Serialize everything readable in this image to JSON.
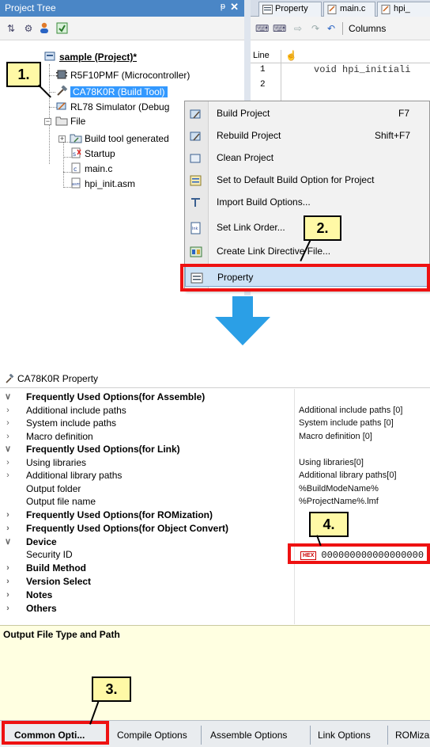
{
  "project_tree": {
    "title": "Project Tree",
    "pin_glyph": "ᵽ",
    "close_glyph": "✕",
    "items": [
      {
        "label": "sample (Project)*"
      },
      {
        "label": "R5F10PMF (Microcontroller)"
      },
      {
        "label": "CA78K0R (Build Tool)"
      },
      {
        "label": "RL78 Simulator (Debug"
      },
      {
        "label": "File"
      },
      {
        "label": "Build tool generated"
      },
      {
        "label": "Startup"
      },
      {
        "label": "main.c"
      },
      {
        "label": "hpi_init.asm"
      }
    ]
  },
  "editor": {
    "tabs": [
      {
        "label": "Property"
      },
      {
        "label": "main.c"
      },
      {
        "label": "hpi_"
      }
    ],
    "columns_label": "Columns",
    "line_header": "Line",
    "lines": [
      {
        "num": "1",
        "code": "void hpi_initiali"
      },
      {
        "num": "2",
        "code": ""
      }
    ]
  },
  "context_menu": {
    "items": [
      {
        "label": "Build Project",
        "shortcut": "F7"
      },
      {
        "label": "Rebuild Project",
        "shortcut": "Shift+F7"
      },
      {
        "label": "Clean Project",
        "shortcut": ""
      },
      {
        "label": "Set to Default Build Option for Project",
        "shortcut": ""
      },
      {
        "label": "Import Build Options...",
        "shortcut": ""
      },
      {
        "label": "Set Link Order...",
        "shortcut": ""
      },
      {
        "label": "Create Link Directive File...",
        "shortcut": ""
      },
      {
        "label": "Property",
        "shortcut": ""
      }
    ]
  },
  "callouts": {
    "c1": "1.",
    "c2": "2.",
    "c3": "3.",
    "c4": "4."
  },
  "property_panel": {
    "title": "CA78K0R Property",
    "rows": [
      {
        "name": "Frequently Used Options(for Assemble)",
        "value": "",
        "chev": "∨"
      },
      {
        "name": "Additional include paths",
        "value": "Additional include paths [0]",
        "chev": "›"
      },
      {
        "name": "System include paths",
        "value": "System include paths [0]",
        "chev": "›"
      },
      {
        "name": "Macro definition",
        "value": "Macro definition [0]",
        "chev": "›"
      },
      {
        "name": "Frequently Used Options(for Link)",
        "value": "",
        "chev": "∨"
      },
      {
        "name": "Using libraries",
        "value": "Using libraries[0]",
        "chev": "›"
      },
      {
        "name": "Additional library paths",
        "value": "Additional library paths[0]",
        "chev": "›"
      },
      {
        "name": "Output folder",
        "value": "%BuildModeName%",
        "chev": ""
      },
      {
        "name": "Output file name",
        "value": "%ProjectName%.lmf",
        "chev": ""
      },
      {
        "name": "Frequently Used Options(for ROMization)",
        "value": "",
        "chev": "›"
      },
      {
        "name": "Frequently Used Options(for Object Convert)",
        "value": "",
        "chev": "›"
      },
      {
        "name": "Device",
        "value": "",
        "chev": "∨"
      },
      {
        "name": "Security ID",
        "value": "000000000000000000",
        "chev": ""
      },
      {
        "name": "Build Method",
        "value": "",
        "chev": "›"
      },
      {
        "name": "Version Select",
        "value": "",
        "chev": "›"
      },
      {
        "name": "Notes",
        "value": "",
        "chev": "›"
      },
      {
        "name": "Others",
        "value": "",
        "chev": "›"
      }
    ],
    "hex_badge": "HEX",
    "description_title": "Output File Type and Path",
    "tabs": [
      {
        "label": "Common Opti..."
      },
      {
        "label": "Compile Options"
      },
      {
        "label": "Assemble Options"
      },
      {
        "label": "Link Options"
      },
      {
        "label": "ROMiza"
      }
    ]
  },
  "colors": {
    "accent": "#4a86c6",
    "selection": "#3399ff",
    "highlight_red": "#ee1111",
    "callout_fill": "#fff9a6",
    "arrow": "#2b9fe6"
  }
}
